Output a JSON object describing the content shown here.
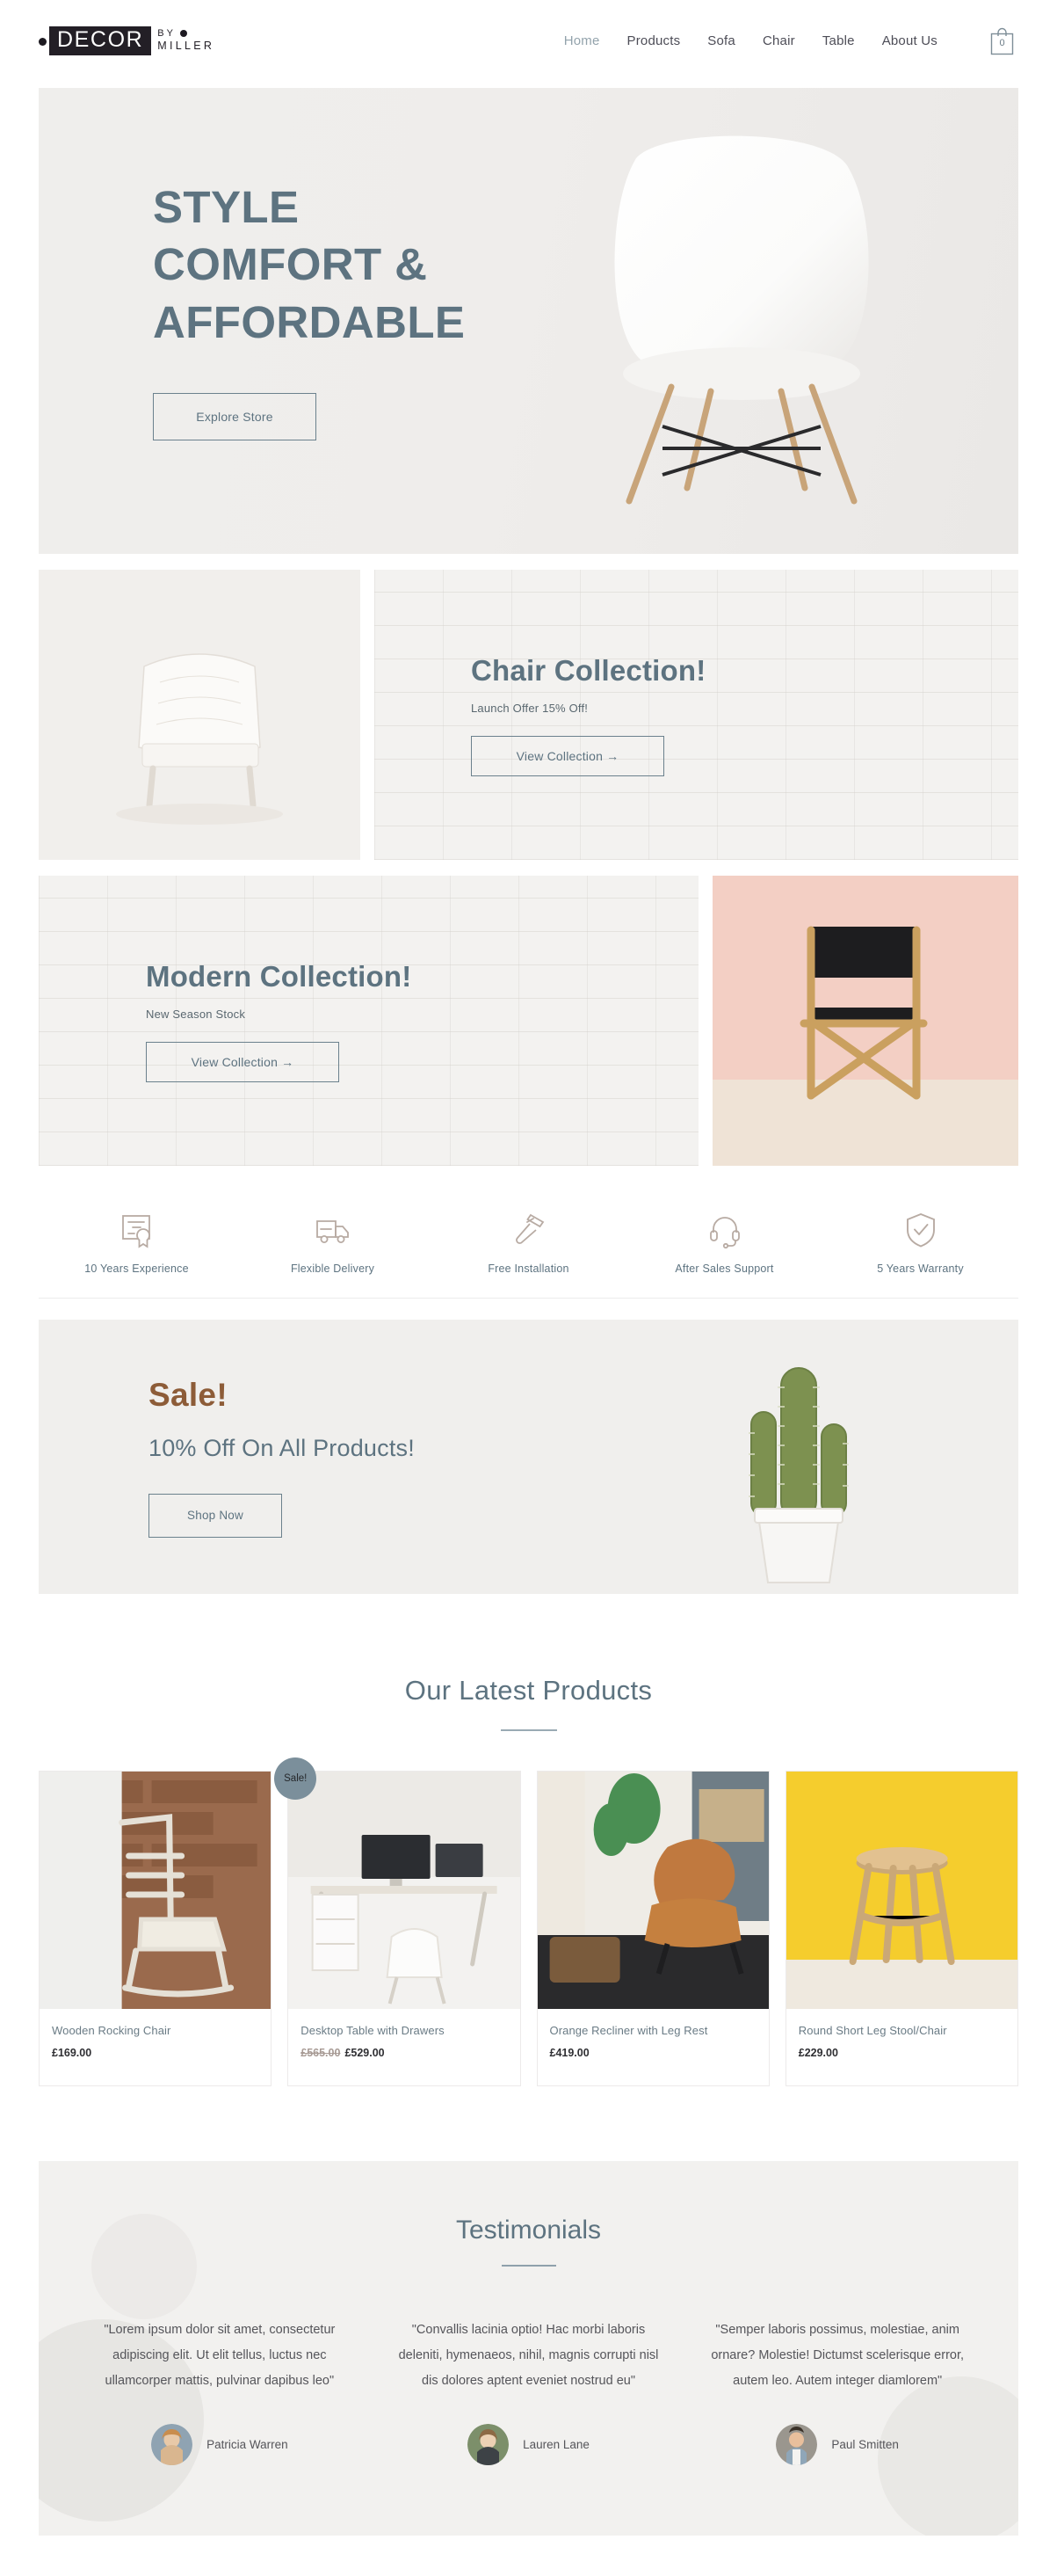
{
  "brand": {
    "name_box": "DECOR",
    "by": "BY",
    "miller": "MILLER"
  },
  "nav": {
    "items": [
      {
        "label": "Home",
        "active": true
      },
      {
        "label": "Products",
        "active": false
      },
      {
        "label": "Sofa",
        "active": false
      },
      {
        "label": "Chair",
        "active": false
      },
      {
        "label": "Table",
        "active": false
      },
      {
        "label": "About Us",
        "active": false
      }
    ],
    "cart_count": "0",
    "cart_icon": "shopping-bag-icon"
  },
  "hero": {
    "line1": "STYLE",
    "line2": "COMFORT &",
    "line3": "AFFORDABLE",
    "cta": "Explore Store",
    "image_alt": "white-molded-chair-photo"
  },
  "collections": [
    {
      "title": "Chair Collection!",
      "subtitle": "Launch Offer 15% Off!",
      "cta": "View Collection →",
      "image_alt": "white-tufted-armchair-photo"
    },
    {
      "title": "Modern Collection!",
      "subtitle": "New Season Stock",
      "cta": "View Collection →",
      "image_alt": "directors-chair-pink-background-photo"
    }
  ],
  "features": [
    {
      "label": "10 Years Experience",
      "icon": "certificate-icon"
    },
    {
      "label": "Flexible Delivery",
      "icon": "delivery-truck-icon"
    },
    {
      "label": "Free Installation",
      "icon": "hammer-icon"
    },
    {
      "label": "After Sales Support",
      "icon": "headset-icon"
    },
    {
      "label": "5 Years Warranty",
      "icon": "shield-check-icon"
    }
  ],
  "sale": {
    "title": "Sale!",
    "subtitle": "10% Off On All Products!",
    "cta": "Shop Now",
    "title_color": "#8d5c38",
    "image_alt": "cactus-in-white-pot-photo"
  },
  "products_section": {
    "heading": "Our Latest Products",
    "items": [
      {
        "name": "Wooden Rocking Chair",
        "price": "£169.00",
        "old_price": "",
        "badge": "",
        "image_alt": "wooden-rocking-chair-brick-wall-photo"
      },
      {
        "name": "Desktop Table with Drawers",
        "price": "£529.00",
        "old_price": "£565.00",
        "badge": "Sale!",
        "image_alt": "white-desk-with-monitors-photo"
      },
      {
        "name": "Orange Recliner with Leg Rest",
        "price": "£419.00",
        "old_price": "",
        "badge": "",
        "image_alt": "tan-leather-recliner-lounge-photo"
      },
      {
        "name": "Round Short Leg Stool/Chair",
        "price": "£229.00",
        "old_price": "",
        "badge": "",
        "image_alt": "round-stool-yellow-background-photo"
      }
    ]
  },
  "testimonials_section": {
    "heading": "Testimonials",
    "items": [
      {
        "quote": "\"Lorem ipsum dolor sit amet, consectetur adipiscing elit. Ut elit tellus, luctus nec ullamcorper mattis, pulvinar dapibus leo\"",
        "name": "Patricia Warren",
        "avatar_alt": "avatar-patricia-warren"
      },
      {
        "quote": "\"Convallis lacinia optio! Hac morbi laboris deleniti, hymenaeos, nihil, magnis corrupti nisl dis dolores aptent eveniet nostrud eu\"",
        "name": "Lauren Lane",
        "avatar_alt": "avatar-lauren-lane"
      },
      {
        "quote": "\"Semper laboris possimus, molestiae, anim ornare? Molestie! Dictumst scelerisque error, autem leo. Autem integer diamlorem\"",
        "name": "Paul Smitten",
        "avatar_alt": "avatar-paul-smitten"
      }
    ]
  },
  "colors": {
    "accent_slate": "#5d7380",
    "accent_brown": "#8d5c38",
    "panel_gray": "#f2f1ef",
    "ink": "#231f26"
  }
}
